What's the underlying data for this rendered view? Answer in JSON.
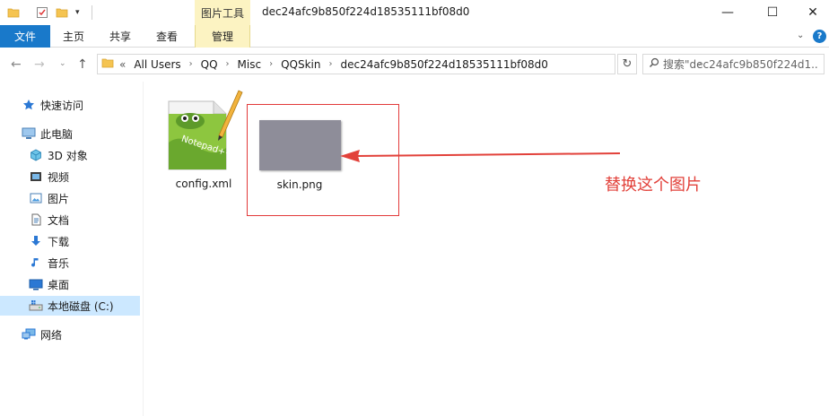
{
  "titlebar": {
    "tool_context_title": "图片工具",
    "window_title": "dec24afc9b850f224d18535111bf08d0",
    "minimize": "—",
    "maximize": "☐",
    "close": "✕",
    "qa_dropdown": "▾"
  },
  "ribbon": {
    "tabs": [
      {
        "label": "文件"
      },
      {
        "label": "主页"
      },
      {
        "label": "共享"
      },
      {
        "label": "查看"
      },
      {
        "label": "管理"
      }
    ],
    "expand": "⌄",
    "help": "?"
  },
  "nav": {
    "back": "←",
    "forward": "→",
    "recent": "⌄",
    "up": "↑",
    "address_chevrons": "«",
    "breadcrumb": [
      "All Users",
      "QQ",
      "Misc",
      "QQSkin",
      "dec24afc9b850f224d18535111bf08d0"
    ],
    "crumb_separator": "›",
    "address_dropdown": "⌄",
    "refresh": "↻",
    "search_placeholder": "搜索\"dec24afc9b850f224d1..."
  },
  "sidebar": {
    "items": [
      {
        "label": "快速访问",
        "icon": "star-icon"
      },
      {
        "label": "此电脑",
        "icon": "computer-icon"
      },
      {
        "label": "3D 对象",
        "icon": "3d-objects-icon"
      },
      {
        "label": "视频",
        "icon": "video-icon"
      },
      {
        "label": "图片",
        "icon": "pictures-icon"
      },
      {
        "label": "文档",
        "icon": "documents-icon"
      },
      {
        "label": "下载",
        "icon": "download-icon"
      },
      {
        "label": "音乐",
        "icon": "music-icon"
      },
      {
        "label": "桌面",
        "icon": "desktop-icon"
      },
      {
        "label": "本地磁盘 (C:)",
        "icon": "drive-icon",
        "selected": true
      },
      {
        "label": "网络",
        "icon": "network-icon"
      }
    ]
  },
  "files": [
    {
      "name": "config.xml",
      "icon": "notepadpp-file-icon"
    },
    {
      "name": "skin.png",
      "icon": "image-thumbnail"
    }
  ],
  "annotation": {
    "text": "替换这个图片",
    "color": "#e2413a"
  },
  "colors": {
    "accent": "#1979ca",
    "tool_tab": "#fcf3c2",
    "selection": "#cce8ff",
    "thumbnail": "#8e8d99"
  }
}
